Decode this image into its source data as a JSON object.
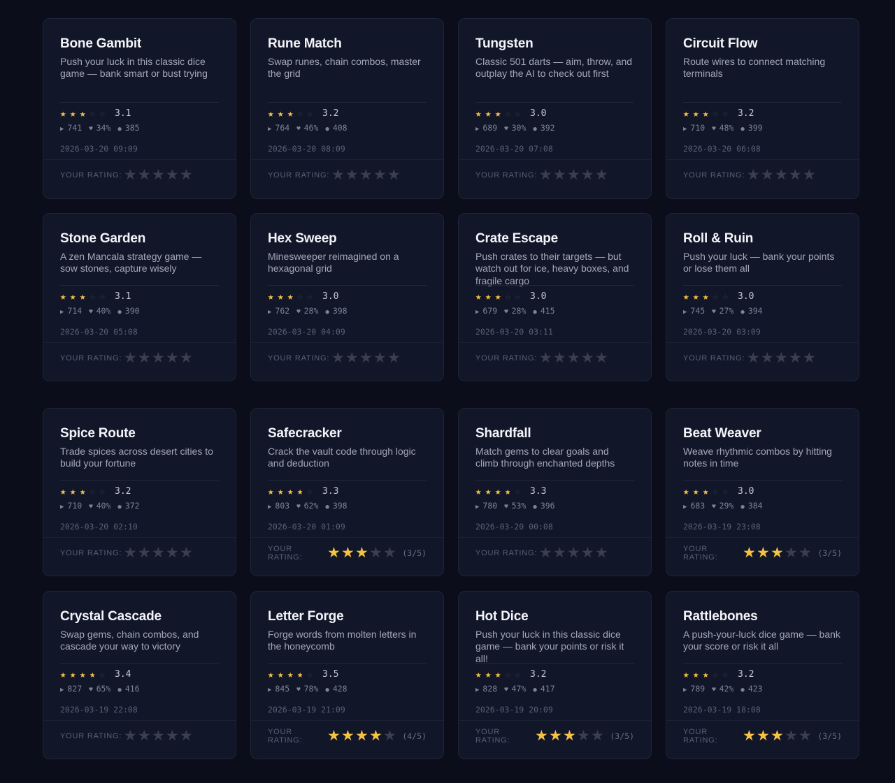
{
  "colors": {
    "background": "#0b0d1a",
    "card": "#121629",
    "star": "#f5c242",
    "star_empty": "#3a3f52"
  },
  "labels": {
    "your_rating": "YOUR RATING:"
  },
  "icons": {
    "plays": "play-icon",
    "likes": "heart-icon",
    "comments": "dot-icon"
  },
  "games": [
    {
      "title": "Bone Gambit",
      "description": "Push your luck in this classic dice game — bank smart or bust trying",
      "rating": "3.1",
      "rating_value": 3.1,
      "plays": "741",
      "likes": "34%",
      "comments": "385",
      "date": "2026-03-20 09:09",
      "user_rating": 0,
      "user_rating_text": ""
    },
    {
      "title": "Rune Match",
      "description": "Swap runes, chain combos, master the grid",
      "rating": "3.2",
      "rating_value": 3.2,
      "plays": "764",
      "likes": "46%",
      "comments": "408",
      "date": "2026-03-20 08:09",
      "user_rating": 0,
      "user_rating_text": ""
    },
    {
      "title": "Tungsten",
      "description": "Classic 501 darts — aim, throw, and outplay the AI to check out first",
      "rating": "3.0",
      "rating_value": 3.0,
      "plays": "689",
      "likes": "30%",
      "comments": "392",
      "date": "2026-03-20 07:08",
      "user_rating": 0,
      "user_rating_text": ""
    },
    {
      "title": "Circuit Flow",
      "description": "Route wires to connect matching terminals",
      "rating": "3.2",
      "rating_value": 3.2,
      "plays": "710",
      "likes": "48%",
      "comments": "399",
      "date": "2026-03-20 06:08",
      "user_rating": 0,
      "user_rating_text": ""
    },
    {
      "title": "Stone Garden",
      "description": "A zen Mancala strategy game — sow stones, capture wisely",
      "rating": "3.1",
      "rating_value": 3.1,
      "plays": "714",
      "likes": "40%",
      "comments": "390",
      "date": "2026-03-20 05:08",
      "user_rating": 0,
      "user_rating_text": ""
    },
    {
      "title": "Hex Sweep",
      "description": "Minesweeper reimagined on a hexagonal grid",
      "rating": "3.0",
      "rating_value": 3.0,
      "plays": "762",
      "likes": "28%",
      "comments": "398",
      "date": "2026-03-20 04:09",
      "user_rating": 0,
      "user_rating_text": ""
    },
    {
      "title": "Crate Escape",
      "description": "Push crates to their targets — but watch out for ice, heavy boxes, and fragile cargo",
      "rating": "3.0",
      "rating_value": 3.0,
      "plays": "679",
      "likes": "28%",
      "comments": "415",
      "date": "2026-03-20 03:11",
      "user_rating": 0,
      "user_rating_text": ""
    },
    {
      "title": "Roll & Ruin",
      "description": "Push your luck — bank your points or lose them all",
      "rating": "3.0",
      "rating_value": 3.0,
      "plays": "745",
      "likes": "27%",
      "comments": "394",
      "date": "2026-03-20 03:09",
      "user_rating": 0,
      "user_rating_text": ""
    },
    {
      "title": "Spice Route",
      "description": "Trade spices across desert cities to build your fortune",
      "rating": "3.2",
      "rating_value": 3.2,
      "plays": "710",
      "likes": "40%",
      "comments": "372",
      "date": "2026-03-20 02:10",
      "user_rating": 0,
      "user_rating_text": ""
    },
    {
      "title": "Safecracker",
      "description": "Crack the vault code through logic and deduction",
      "rating": "3.3",
      "rating_value": 3.3,
      "plays": "803",
      "likes": "62%",
      "comments": "398",
      "date": "2026-03-20 01:09",
      "user_rating": 3,
      "user_rating_text": "(3/5)"
    },
    {
      "title": "Shardfall",
      "description": "Match gems to clear goals and climb through enchanted depths",
      "rating": "3.3",
      "rating_value": 3.3,
      "plays": "780",
      "likes": "53%",
      "comments": "396",
      "date": "2026-03-20 00:08",
      "user_rating": 0,
      "user_rating_text": ""
    },
    {
      "title": "Beat Weaver",
      "description": "Weave rhythmic combos by hitting notes in time",
      "rating": "3.0",
      "rating_value": 3.0,
      "plays": "683",
      "likes": "29%",
      "comments": "384",
      "date": "2026-03-19 23:08",
      "user_rating": 3,
      "user_rating_text": "(3/5)"
    },
    {
      "title": "Crystal Cascade",
      "description": "Swap gems, chain combos, and cascade your way to victory",
      "rating": "3.4",
      "rating_value": 3.4,
      "plays": "827",
      "likes": "65%",
      "comments": "416",
      "date": "2026-03-19 22:08",
      "user_rating": 0,
      "user_rating_text": ""
    },
    {
      "title": "Letter Forge",
      "description": "Forge words from molten letters in the honeycomb",
      "rating": "3.5",
      "rating_value": 3.5,
      "plays": "845",
      "likes": "78%",
      "comments": "428",
      "date": "2026-03-19 21:09",
      "user_rating": 4,
      "user_rating_text": "(4/5)"
    },
    {
      "title": "Hot Dice",
      "description": "Push your luck in this classic dice game — bank your points or risk it all!",
      "rating": "3.2",
      "rating_value": 3.2,
      "plays": "828",
      "likes": "47%",
      "comments": "417",
      "date": "2026-03-19 20:09",
      "user_rating": 3,
      "user_rating_text": "(3/5)"
    },
    {
      "title": "Rattlebones",
      "description": "A push-your-luck dice game — bank your score or risk it all",
      "rating": "3.2",
      "rating_value": 3.2,
      "plays": "789",
      "likes": "42%",
      "comments": "423",
      "date": "2026-03-19 18:08",
      "user_rating": 3,
      "user_rating_text": "(3/5)"
    }
  ]
}
